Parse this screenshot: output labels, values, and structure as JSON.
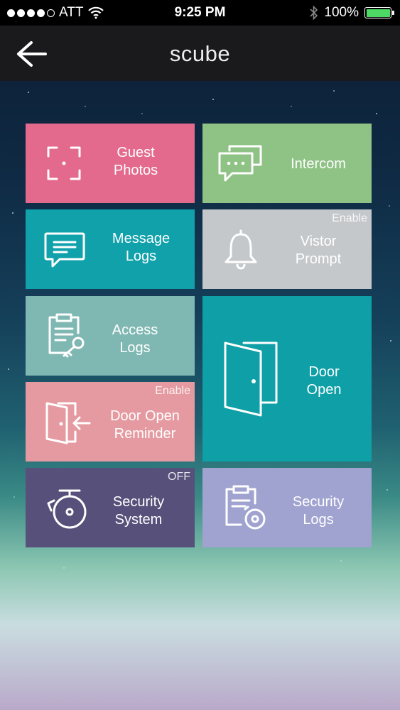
{
  "status_bar": {
    "carrier": "ATT",
    "time": "9:25 PM",
    "battery": "100%",
    "battery_level": 1.0,
    "battery_color": "#4cd964"
  },
  "header": {
    "title": "scube",
    "back_icon": "arrow-left-icon"
  },
  "tiles": {
    "guest_photos": {
      "line1": "Guest",
      "line2": "Photos",
      "color": "#e46a8d",
      "icon": "camera-focus-icon"
    },
    "intercom": {
      "line1": "Intercom",
      "color": "#8fc285",
      "icon": "chat-bubbles-icon"
    },
    "message_logs": {
      "line1": "Message",
      "line2": "Logs",
      "color": "#10a1ab",
      "icon": "message-icon"
    },
    "visitor_prompt": {
      "line1": "Vistor",
      "line2": "Prompt",
      "badge": "Enable",
      "color": "#c5c8cb",
      "icon": "bell-icon"
    },
    "access_logs": {
      "line1": "Access",
      "line2": "Logs",
      "color": "#7fb7b2",
      "icon": "clipboard-key-icon"
    },
    "door_open": {
      "line1": "Door",
      "line2": "Open",
      "color": "#0e9fa7",
      "icon": "door-open-icon"
    },
    "door_open_reminder": {
      "line1": "Door Open",
      "line2": "Reminder",
      "badge": "Enable",
      "color": "#e49aa0",
      "icon": "door-enter-icon"
    },
    "security_system": {
      "line1": "Security",
      "line2": "System",
      "badge": "OFF",
      "color": "#56507a",
      "icon": "alarm-bell-icon"
    },
    "security_logs": {
      "line1": "Security",
      "line2": "Logs",
      "color": "#a0a3d0",
      "icon": "clipboard-alarm-icon"
    }
  }
}
